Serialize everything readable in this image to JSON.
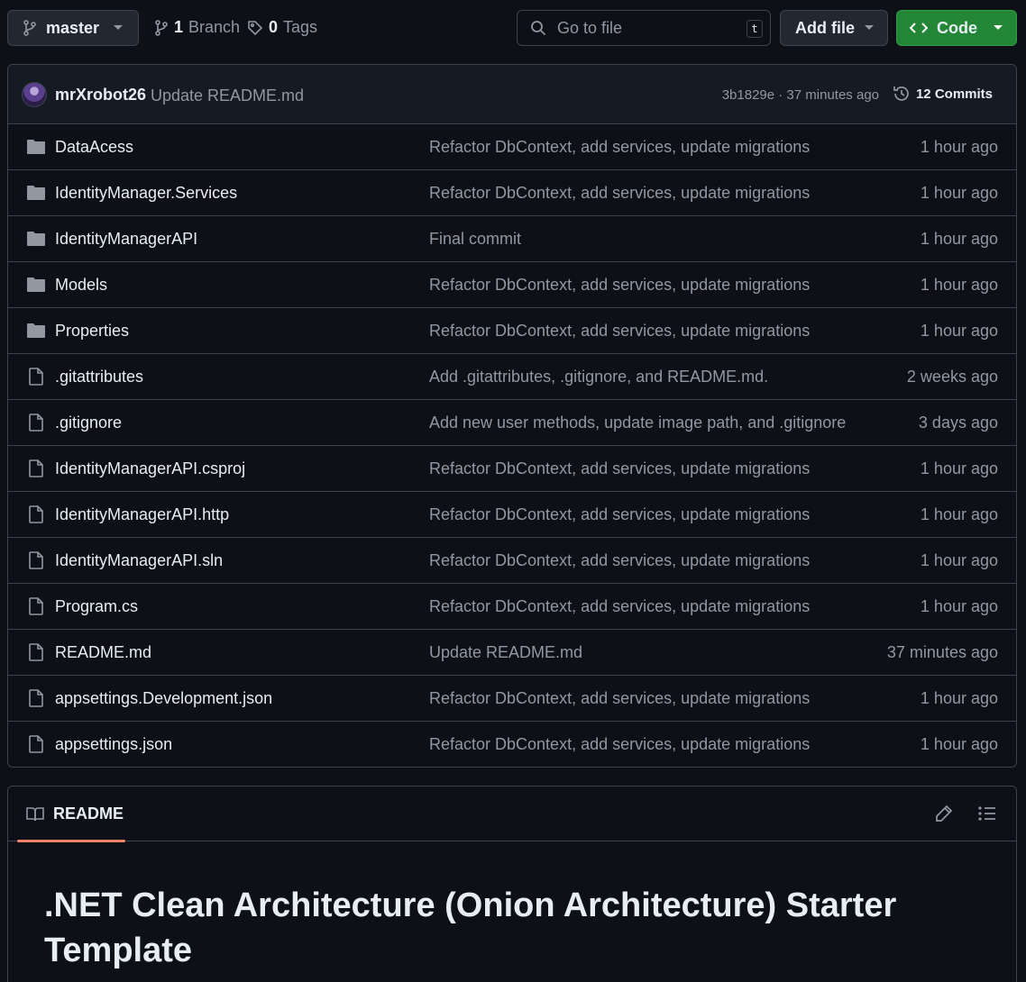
{
  "toolbar": {
    "branch": "master",
    "branch_count": "1",
    "branch_label": "Branch",
    "tag_count": "0",
    "tag_label": "Tags",
    "goto_placeholder": "Go to file",
    "goto_shortcut": "t",
    "add_file_label": "Add file",
    "code_label": "Code"
  },
  "latest_commit": {
    "author": "mrXrobot26",
    "message": "Update README.md",
    "sha_time": "3b1829e · 37 minutes ago",
    "commits_label": "12 Commits"
  },
  "files": [
    {
      "type": "dir",
      "name": "DataAcess",
      "message": "Refactor DbContext, add services, update migrations",
      "time": "1 hour ago"
    },
    {
      "type": "dir",
      "name": "IdentityManager.Services",
      "message": "Refactor DbContext, add services, update migrations",
      "time": "1 hour ago"
    },
    {
      "type": "dir",
      "name": "IdentityManagerAPI",
      "message": "Final commit",
      "time": "1 hour ago"
    },
    {
      "type": "dir",
      "name": "Models",
      "message": "Refactor DbContext, add services, update migrations",
      "time": "1 hour ago"
    },
    {
      "type": "dir",
      "name": "Properties",
      "message": "Refactor DbContext, add services, update migrations",
      "time": "1 hour ago"
    },
    {
      "type": "file",
      "name": ".gitattributes",
      "message": "Add .gitattributes, .gitignore, and README.md.",
      "time": "2 weeks ago"
    },
    {
      "type": "file",
      "name": ".gitignore",
      "message": "Add new user methods, update image path, and .gitignore",
      "time": "3 days ago"
    },
    {
      "type": "file",
      "name": "IdentityManagerAPI.csproj",
      "message": "Refactor DbContext, add services, update migrations",
      "time": "1 hour ago"
    },
    {
      "type": "file",
      "name": "IdentityManagerAPI.http",
      "message": "Refactor DbContext, add services, update migrations",
      "time": "1 hour ago"
    },
    {
      "type": "file",
      "name": "IdentityManagerAPI.sln",
      "message": "Refactor DbContext, add services, update migrations",
      "time": "1 hour ago"
    },
    {
      "type": "file",
      "name": "Program.cs",
      "message": "Refactor DbContext, add services, update migrations",
      "time": "1 hour ago"
    },
    {
      "type": "file",
      "name": "README.md",
      "message": "Update README.md",
      "time": "37 minutes ago"
    },
    {
      "type": "file",
      "name": "appsettings.Development.json",
      "message": "Refactor DbContext, add services, update migrations",
      "time": "1 hour ago"
    },
    {
      "type": "file",
      "name": "appsettings.json",
      "message": "Refactor DbContext, add services, update migrations",
      "time": "1 hour ago"
    }
  ],
  "readme": {
    "tab_label": "README",
    "title_line1": ".NET Clean Architecture (Onion Architecture) Starter",
    "title_line2": "Template"
  },
  "colors": {
    "background": "#0d1117",
    "border": "#3d444d",
    "muted_text": "#9198a1",
    "primary_button": "#238636",
    "tab_underline": "#f78166"
  }
}
